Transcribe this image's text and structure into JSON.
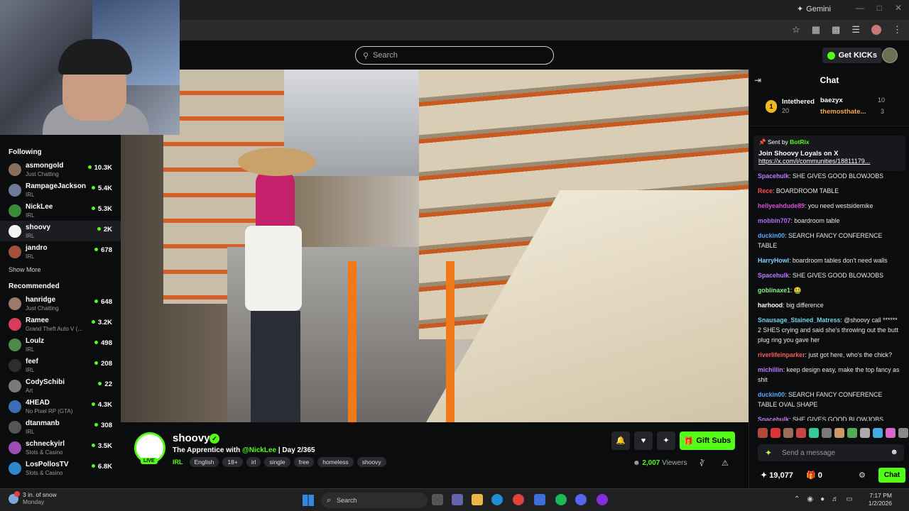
{
  "browser": {
    "ai_label": "Gemini"
  },
  "header": {
    "search_placeholder": "Search",
    "get_kicks_label": "Get KICKs"
  },
  "sidebar": {
    "following_title": "Following",
    "following": [
      {
        "name": "asmongold",
        "category": "Just Chatting",
        "viewers": "10.3K",
        "color": "#8a6e5c"
      },
      {
        "name": "RampageJackson",
        "category": "IRL",
        "viewers": "5.4K",
        "color": "#6d7b99"
      },
      {
        "name": "NickLee",
        "category": "IRL",
        "viewers": "5.3K",
        "color": "#3a8a3a"
      },
      {
        "name": "shoovy",
        "category": "IRL",
        "viewers": "2K",
        "color": "#f4f4f4"
      },
      {
        "name": "jandro",
        "category": "IRL",
        "viewers": "678",
        "color": "#a0523d"
      }
    ],
    "show_more_label": "Show More",
    "recommended_title": "Recommended",
    "recommended": [
      {
        "name": "hanridge",
        "category": "Just Chatting",
        "viewers": "648",
        "color": "#9b7a6a"
      },
      {
        "name": "Ramee",
        "category": "Grand Theft Auto V (...",
        "viewers": "3.2K",
        "color": "#d63c5b"
      },
      {
        "name": "Loulz",
        "category": "IRL",
        "viewers": "498",
        "color": "#4c8a4c"
      },
      {
        "name": "feef",
        "category": "IRL",
        "viewers": "208",
        "color": "#2d2d2d"
      },
      {
        "name": "CodySchibi",
        "category": "Art",
        "viewers": "22",
        "color": "#7a7a7a"
      },
      {
        "name": "4HEAD",
        "category": "No Pixel RP (GTA)",
        "viewers": "4.3K",
        "color": "#3a6fb3"
      },
      {
        "name": "dtanmanb",
        "category": "IRL",
        "viewers": "308",
        "color": "#555"
      },
      {
        "name": "schneckyirl",
        "category": "Slots & Casino",
        "viewers": "3.5K",
        "color": "#9a4db3"
      },
      {
        "name": "LosPollosTV",
        "category": "Slots & Casino",
        "viewers": "6.8K",
        "color": "#2f86c9"
      }
    ]
  },
  "stream": {
    "live_label": "LIVE",
    "streamer": "shoovy",
    "title_prefix": "The Apprentice with ",
    "title_mention": "@NickLee",
    "title_suffix": " | Day 2/365",
    "category": "IRL",
    "tags": [
      "English",
      "18+",
      "irl",
      "single",
      "free",
      "homeless",
      "shoovy"
    ],
    "gift_label": "Gift Subs",
    "viewers_count": "2,007",
    "viewers_label": "Viewers"
  },
  "chat": {
    "title": "Chat",
    "leaderboard": {
      "first_name": "Intethered",
      "first_score": "20",
      "first_rank": "1",
      "second_name": "baezyx",
      "second_score": "10",
      "third_name": "themosthate...",
      "third_score": "3"
    },
    "pinned": {
      "sent_by_label": "Sent by",
      "sender": "BotRix",
      "message": "Join Shoovy Loyals on X",
      "link": "https://x.com/i/communities/18811179..."
    },
    "messages": [
      {
        "user": "Spacehulk",
        "color": "#c07bff",
        "text": "SHE GIVES GOOD BLOWJOBS"
      },
      {
        "user": "Rece",
        "color": "#ff4e4e",
        "text": "BOARDROOM TABLE"
      },
      {
        "user": "hellyeahdude89",
        "color": "#d64fd6",
        "text": "you need westsidemike"
      },
      {
        "user": "mobbin707",
        "color": "#b46cff",
        "text": "boardroom table"
      },
      {
        "user": "duckin00",
        "color": "#5aa9ff",
        "text": "SEARCH FANCY CONFERENCE TABLE"
      },
      {
        "user": "HarryHowl",
        "color": "#7fd4ff",
        "text": "boardroom tables don't need walls"
      },
      {
        "user": "Spacehulk",
        "color": "#c07bff",
        "text": "SHE GIVES GOOD BLOWJOBS"
      },
      {
        "user": "goblinaxe1",
        "color": "#8cf08c",
        "text": "🤮"
      },
      {
        "user": "harhood",
        "color": "#ffffff",
        "text": "big difference"
      },
      {
        "user": "Snausage_Stained_Matress",
        "color": "#6fd3e8",
        "text": "@shoovy call ****** 2 SHES crying and said she's throwing out the butt plug ring you gave her"
      },
      {
        "user": "riverlifeinparker",
        "color": "#ff5a5a",
        "text": "just got here, who's the chick?"
      },
      {
        "user": "michillin",
        "color": "#c07bff",
        "text": "keep design easy, make the top fancy as shit"
      },
      {
        "user": "duckin00",
        "color": "#5aa9ff",
        "text": "SEARCH FANCY CONFERENCE TABLE OVAL SHAPE"
      },
      {
        "user": "Spacehulk",
        "color": "#c07bff",
        "text": "SHE GIVES GOOD BLOWJOBS"
      }
    ],
    "input_placeholder": "Send a message",
    "points": "19,077",
    "gifts": "0",
    "chat_button_label": "Chat"
  },
  "taskbar": {
    "weather_line1": "3 in. of snow",
    "weather_line2": "Monday",
    "search_label": "Search",
    "time": "7:17 PM",
    "date": "1/2/2026"
  }
}
